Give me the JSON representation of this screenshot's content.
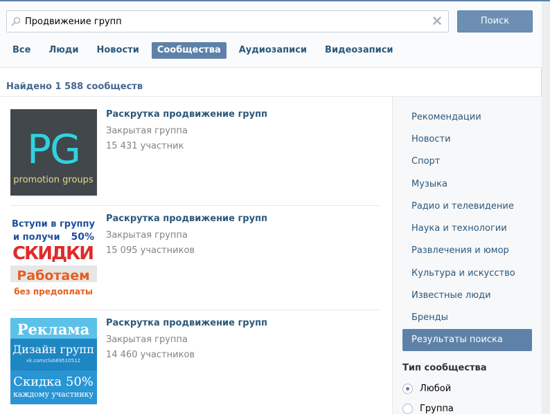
{
  "search": {
    "value": "Продвижение групп",
    "button_label": "Поиск"
  },
  "tabs": [
    {
      "label": "Все",
      "active": false
    },
    {
      "label": "Люди",
      "active": false
    },
    {
      "label": "Новости",
      "active": false
    },
    {
      "label": "Сообщества",
      "active": true
    },
    {
      "label": "Аудиозаписи",
      "active": false
    },
    {
      "label": "Видеозаписи",
      "active": false
    }
  ],
  "found_text": "Найдено 1 588 сообществ",
  "results": [
    {
      "name": "Раскрутка продвижение групп",
      "type": "Закрытая группа",
      "members": "15 431 участник",
      "thumb_text": [
        "PG",
        "promotion groups"
      ]
    },
    {
      "name": "Раскрутка продвижение групп",
      "type": "Закрытая группа",
      "members": "15 095 участников",
      "thumb_text": [
        "Вступи в группу",
        "и получи",
        "50%",
        "СКИДКИ",
        "Работаем",
        "без предоплаты"
      ]
    },
    {
      "name": "Раскрутка продвижение групп",
      "type": "Закрытая группа",
      "members": "14 460 участников",
      "thumb_text": [
        "Реклама",
        "Дизайн групп",
        "vk.com/club69510512",
        "Скидка 50%",
        "каждому участнику"
      ]
    }
  ],
  "sidebar": {
    "items": [
      {
        "label": "Рекомендации",
        "active": false
      },
      {
        "label": "Новости",
        "active": false
      },
      {
        "label": "Спорт",
        "active": false
      },
      {
        "label": "Музыка",
        "active": false
      },
      {
        "label": "Радио и телевидение",
        "active": false
      },
      {
        "label": "Наука и технологии",
        "active": false
      },
      {
        "label": "Развлечения и юмор",
        "active": false
      },
      {
        "label": "Культура и искусство",
        "active": false
      },
      {
        "label": "Известные люди",
        "active": false
      },
      {
        "label": "Бренды",
        "active": false
      },
      {
        "label": "Результаты поиска",
        "active": true
      }
    ],
    "filter_title": "Тип сообщества",
    "filter_options": [
      {
        "label": "Любой",
        "checked": true
      },
      {
        "label": "Группа",
        "checked": false
      }
    ]
  },
  "icons": {
    "search": "magnifier-icon",
    "clear": "close-icon"
  },
  "colors": {
    "accent": "#5e81a8",
    "link": "#2b587a",
    "muted": "#828282"
  }
}
